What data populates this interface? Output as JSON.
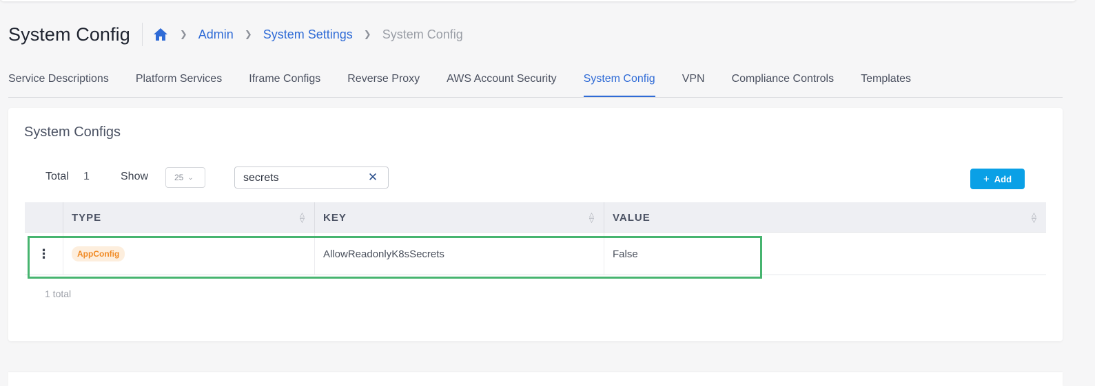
{
  "header": {
    "title": "System Config",
    "breadcrumb": {
      "home_icon": "home-icon",
      "items": [
        "Admin",
        "System Settings"
      ],
      "current": "System Config"
    }
  },
  "tabs": [
    {
      "label": "Service Descriptions"
    },
    {
      "label": "Platform Services"
    },
    {
      "label": "Iframe Configs"
    },
    {
      "label": "Reverse Proxy"
    },
    {
      "label": "AWS Account Security"
    },
    {
      "label": "System Config",
      "active": true
    },
    {
      "label": "VPN"
    },
    {
      "label": "Compliance Controls"
    },
    {
      "label": "Templates"
    }
  ],
  "card": {
    "title": "System Configs",
    "toolbar": {
      "total_label": "Total",
      "total_value": "1",
      "show_label": "Show",
      "page_size": "25",
      "search_value": "secrets",
      "add_label": "Add"
    },
    "table": {
      "columns": [
        "TYPE",
        "KEY",
        "VALUE"
      ],
      "rows": [
        {
          "type": "AppConfig",
          "key": "AllowReadonlyK8sSecrets",
          "value": "False"
        }
      ]
    },
    "footer_total": "1 total"
  },
  "colors": {
    "accent": "#2f6bd6",
    "add_button": "#0aa0e6",
    "badge_text": "#f08a24",
    "badge_bg": "#fdeedd",
    "highlight_border": "#46b46f"
  }
}
